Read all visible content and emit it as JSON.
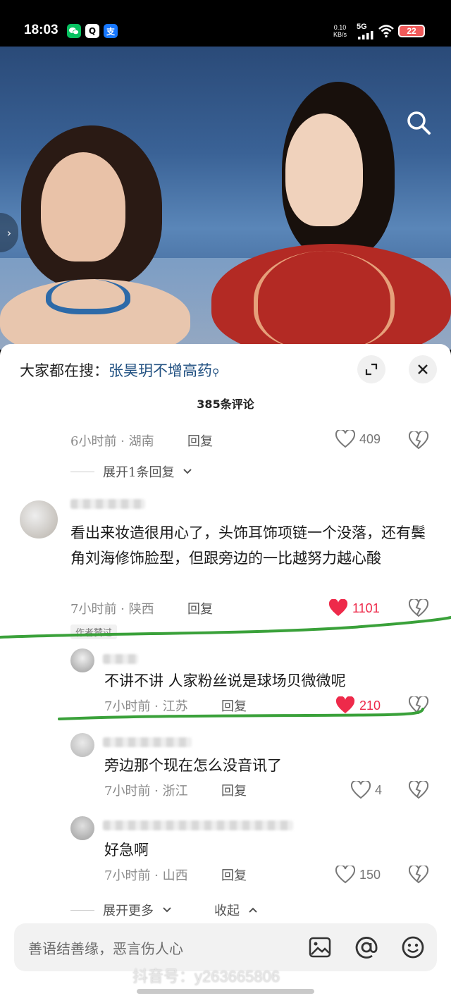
{
  "status_bar": {
    "time": "18:03",
    "app_icons": [
      "wechat-icon",
      "qq-icon",
      "alipay-icon"
    ],
    "app_badges": {
      "qq": "Q",
      "alipay": "支"
    },
    "net_speed_value": "0.10",
    "net_speed_unit": "KB/s",
    "network": "5G",
    "battery": "22"
  },
  "search_hint": {
    "prefix": "大家都在搜：",
    "keyword": "张昊玥不增高药",
    "icon": "search-icon"
  },
  "comments_header": "385条评论",
  "comments": [
    {
      "time_location": "6小时前 · 湖南",
      "reply": "回复",
      "likes": "409",
      "liked": false
    },
    {
      "text": "看出来妆造很用心了，头饰耳饰项链一个没落，还有鬓角刘海修饰脸型，但跟旁边的一比越努力越心酸",
      "time_location": "7小时前 · 陕西",
      "reply": "回复",
      "likes": "1101",
      "liked": true,
      "badge": "作者赞过",
      "replies": [
        {
          "text": "不讲不讲 人家粉丝说是球场贝微微呢",
          "time_location": "7小时前 · 江苏",
          "reply": "回复",
          "likes": "210",
          "liked": true
        },
        {
          "text": "旁边那个现在怎么没音讯了",
          "time_location": "7小时前 · 浙江",
          "reply": "回复",
          "likes": "4",
          "liked": false
        },
        {
          "text": "好急啊",
          "time_location": "7小时前 · 山西",
          "reply": "回复",
          "likes": "150",
          "liked": false
        }
      ]
    }
  ],
  "expand_one": "展开1条回复",
  "expand_more": "展开更多",
  "collapse": "收起",
  "input_placeholder": "善语结善缘，恶言伤人心",
  "input_icons": [
    "image-icon",
    "at-icon",
    "emoji-icon"
  ],
  "watermark": "抖音号：y263665806",
  "colors": {
    "like_active": "#ee2a4a",
    "annotation": "#3aa13a",
    "keyword": "#1f4f80"
  }
}
